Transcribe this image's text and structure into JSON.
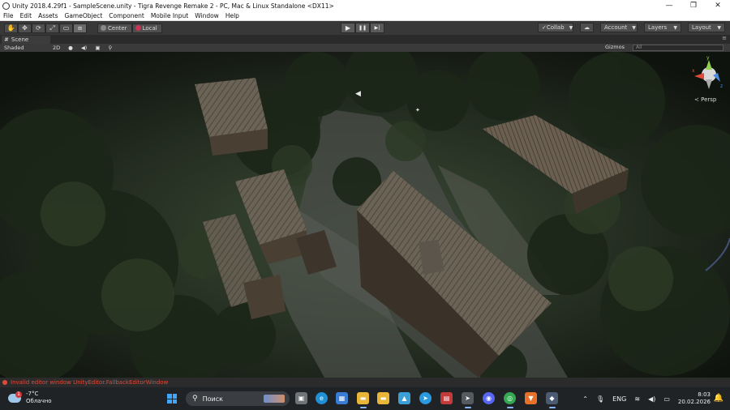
{
  "window": {
    "title": "Unity 2018.4.29f1 - SampleScene.unity - Tigra Revenge Remake 2 - PC, Mac & Linux Standalone <DX11>",
    "controls": [
      "—",
      "❐",
      "✕"
    ]
  },
  "menu": [
    "File",
    "Edit",
    "Assets",
    "GameObject",
    "Component",
    "Mobile Input",
    "Window",
    "Help"
  ],
  "toolbar": {
    "tools": [
      "✋",
      "✥",
      "⟳",
      "⤢",
      "▭",
      "⧈"
    ],
    "pivot_label": "Center",
    "space_label": "Local",
    "play": "▶",
    "pause": "❚❚",
    "step": "▶|",
    "collab_label": "Collab",
    "account_label": "Account",
    "layers_label": "Layers",
    "layout_label": "Layout"
  },
  "scene": {
    "tab_label": "Scene",
    "shading_mode": "Shaded",
    "mode_2d": "2D",
    "gizmos_label": "Gizmos",
    "search_placeholder": "All",
    "projection_label": "Persp",
    "axis_labels": {
      "y": "y",
      "x": "x",
      "z": "z"
    }
  },
  "status": {
    "message": "Invalid editor window UnityEditor.FallbackEditorWindow",
    "color": "#e04a3a"
  },
  "taskbar": {
    "weather_temp": "-7°C",
    "weather_desc": "Облачно",
    "weather_badge": "1",
    "search_label": "Поиск",
    "language": "ENG",
    "time": "8:03",
    "date": "20.02.2026"
  },
  "colors": {
    "editor_bg": "#383838",
    "accent": "#3ea6ff"
  }
}
